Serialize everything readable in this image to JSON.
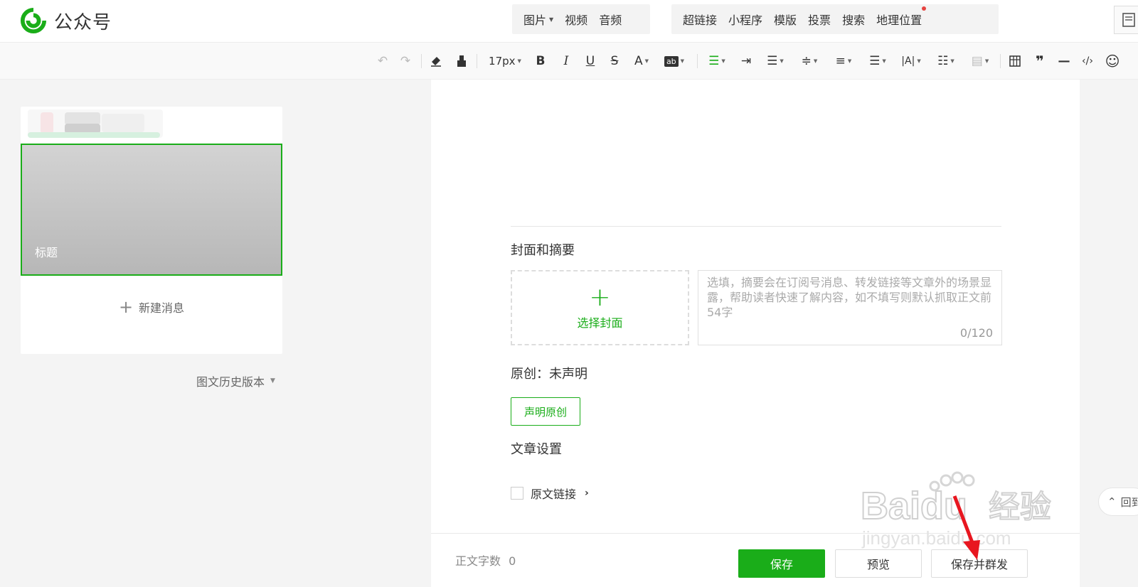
{
  "header": {
    "logo_text": "公众号",
    "media_tools": [
      {
        "label": "图片",
        "has_dropdown": true
      },
      {
        "label": "视频",
        "has_dropdown": false
      },
      {
        "label": "音频",
        "has_dropdown": false
      }
    ],
    "insert_tools": [
      {
        "label": "超链接"
      },
      {
        "label": "小程序"
      },
      {
        "label": "模版"
      },
      {
        "label": "投票"
      },
      {
        "label": "搜索"
      },
      {
        "label": "地理位置",
        "has_red_dot": true
      }
    ]
  },
  "toolbar": {
    "font_size": "17px",
    "buttons": [
      "undo-icon",
      "redo-icon",
      "eraser-icon",
      "format-painter-icon",
      "bold-icon",
      "italic-icon",
      "underline-icon",
      "strikethrough-icon",
      "font-color-icon",
      "background-color-icon",
      "align-icon",
      "indent-icon",
      "line-spacing-icon",
      "paragraph-spacing-icon",
      "letter-spacing-icon",
      "list-icon",
      "table-icon",
      "quote-icon",
      "horizontal-rule-icon",
      "code-icon",
      "emoji-icon"
    ]
  },
  "left": {
    "cover_title": "标题",
    "new_message": "新建消息",
    "history": "图文历史版本"
  },
  "editor": {
    "cover_section_title": "封面和摘要",
    "choose_cover": "选择封面",
    "summary_placeholder": "选填，摘要会在订阅号消息、转发链接等文章外的场景显露，帮助读者快速了解内容，如不填写则默认抓取正文前54字",
    "summary_count": "0/120",
    "original_label": "原创：未声明",
    "declare_original": "声明原创",
    "settings_title": "文章设置",
    "original_link": "原文链接"
  },
  "footer": {
    "word_count_label": "正文字数",
    "word_count": "0",
    "save": "保存",
    "preview": "预览",
    "save_publish": "保存并群发"
  },
  "back_to_top": "回到",
  "watermark": {
    "brand": "Baidu",
    "cn": "经验",
    "url": "jingyan.baidu.com"
  },
  "colors": {
    "accent": "#1aad19",
    "red_dot": "#e64340"
  }
}
